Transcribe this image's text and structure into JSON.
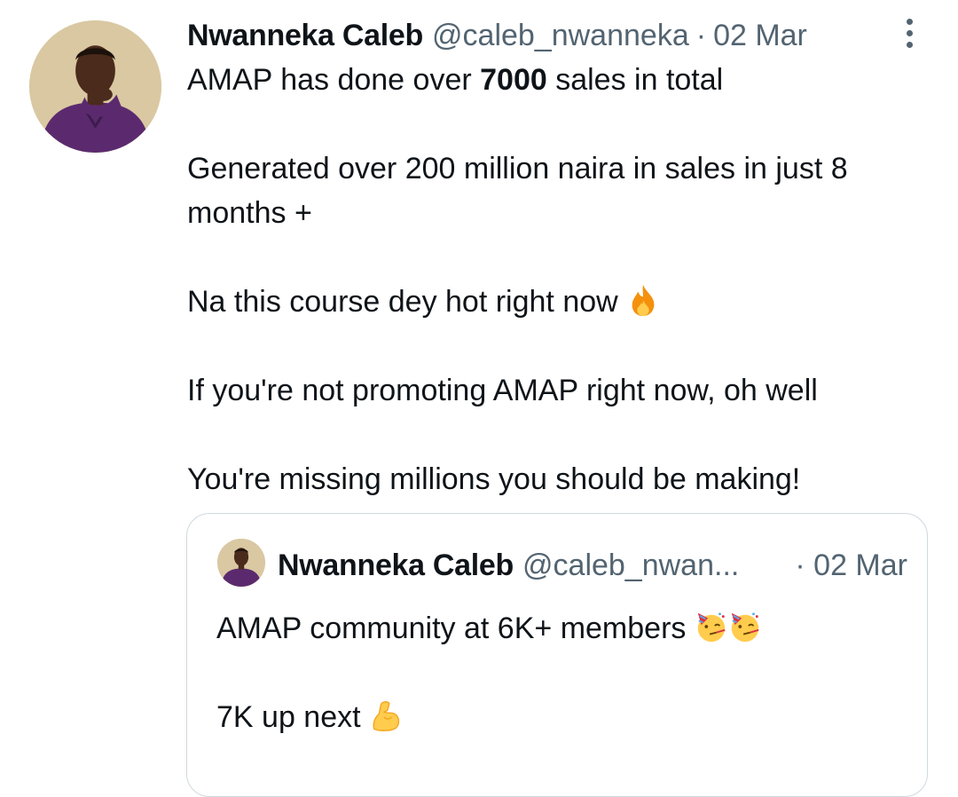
{
  "tweet": {
    "author_name": "Nwanneka Caleb",
    "author_handle": "@caleb_nwanneka",
    "separator": "·",
    "date": "02 Mar",
    "line1_before": "AMAP has done over ",
    "line1_bold": "7000",
    "line1_after": " sales in total",
    "line2": "Generated over 200 million naira in sales in just 8 months +",
    "line3": "Na this course dey hot right now",
    "line3_emoji": "fire-emoji",
    "line4": "If you're not promoting AMAP right now, oh well",
    "line5": "You're missing millions you should be making!"
  },
  "quoted_tweet": {
    "author_name": "Nwanneka Caleb",
    "author_handle": "@caleb_nwan...",
    "separator": "·",
    "date": "02 Mar",
    "line1": "AMAP community at 6K+ members",
    "line1_emojis": [
      "partying-face-emoji",
      "partying-face-emoji"
    ],
    "line2": "7K up next",
    "line2_emoji": "flexed-biceps-emoji"
  },
  "colors": {
    "text": "#0f1419",
    "secondary": "#536471",
    "border": "#cfd9de"
  }
}
